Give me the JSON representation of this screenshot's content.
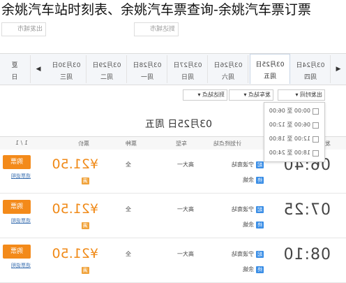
{
  "page_title": "余姚汽车站时刻表、余姚汽车票查询-余姚汽车票订票",
  "search": {
    "from_label": "出发城市",
    "to_label": "到达城市"
  },
  "dates": [
    {
      "date": "03月24日",
      "weekday": "周四"
    },
    {
      "date": "03月25日",
      "weekday": "周五"
    },
    {
      "date": "03月26日",
      "weekday": "周六"
    },
    {
      "date": "03月27日",
      "weekday": "周日"
    },
    {
      "date": "03月28日",
      "weekday": "周一"
    },
    {
      "date": "03月29日",
      "weekday": "周二"
    },
    {
      "date": "03月30日",
      "weekday": "周三"
    },
    {
      "date": "夏",
      "weekday": "日"
    }
  ],
  "filters": {
    "depart_time": "出发时间",
    "depart_station": "发车站点",
    "arrive_station": "到达站点"
  },
  "time_options": [
    {
      "label": "00:00 至 06:00"
    },
    {
      "label": "06:00 至 12:00"
    },
    {
      "label": "12:00 至 18:00"
    },
    {
      "label": "18:00 至 24:00"
    }
  ],
  "day_title": "03月25日 周五",
  "table_headers": {
    "depart": "发车时间/车站",
    "dest": "计划终点站",
    "vehicle": "车型",
    "seat_type": "票种",
    "price": "票价"
  },
  "pager": "1 / 1",
  "trips": [
    {
      "time": "06:40",
      "from_station": "宁波南站",
      "to_station": "余姚",
      "vehicle": "高大一",
      "seat": "全",
      "price": "¥21.50",
      "buy": "购票",
      "refund": "退票说明"
    },
    {
      "time": "07:25",
      "from_station": "宁波南站",
      "to_station": "余姚",
      "vehicle": "高大一",
      "seat": "全",
      "price": "¥21.50",
      "buy": "购票",
      "refund": "退票说明"
    },
    {
      "time": "08:10",
      "from_station": "宁波南站",
      "to_station": "余姚",
      "vehicle": "高大一",
      "seat": "全",
      "price": "¥21.50",
      "buy": "购票",
      "refund": "退票说明"
    }
  ],
  "badge_from": "起",
  "badge_to": "终",
  "badge_seat": "满"
}
